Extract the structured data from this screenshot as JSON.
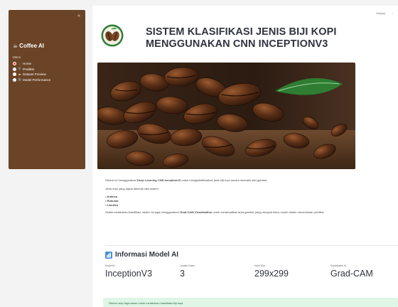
{
  "sidebar": {
    "collapse_icon": "«",
    "app_title": "Coffee AI",
    "menu_label": "Menu",
    "items": [
      {
        "label": "Home",
        "icon": "house-icon",
        "active": true
      },
      {
        "label": "Prediksi",
        "icon": "magnifier-icon",
        "active": false
      },
      {
        "label": "Dataset Preview",
        "icon": "folder-icon",
        "active": false
      },
      {
        "label": "Model Performance",
        "icon": "chart-icon",
        "active": false
      }
    ]
  },
  "topbar": {
    "deploy_label": "Deploy",
    "menu_icon": "⋮"
  },
  "header": {
    "title_line1": "SISTEM KLASIFIKASI JENIS BIJI KOPI",
    "title_line2": "MENGGUNAKAN CNN INCEPTIONV3"
  },
  "description": {
    "intro_pre": "Sistem ini menggunakan ",
    "intro_bold": "Deep Learning CNN InceptionV3",
    "intro_post": " untuk mengklasifikasikan jenis biji kopi secara otomatis dari gambar.",
    "types_intro": "Jenis kopi yang dapat dikenali oleh sistem:",
    "types": [
      "Arabica",
      "Robusta",
      "Liberika"
    ],
    "gradcam_pre": "Selain melakukan klasifikasi, sistem ini juga menggunakan ",
    "gradcam_bold": "Grad-CAM Visualization",
    "gradcam_post": " untuk menampilkan area gambar yang menjadi fokus model dalam menentukan prediksi."
  },
  "model_info": {
    "title": "Informasi Model AI",
    "icon": "bar-chart-icon",
    "metrics": [
      {
        "label": "Model AI",
        "value": "InceptionV3"
      },
      {
        "label": "Jumlah Kelas",
        "value": "3"
      },
      {
        "label": "Input Size",
        "value": "299x299"
      },
      {
        "label": "Explainable AI",
        "value": "Grad-CAM"
      }
    ]
  },
  "status": {
    "message": "Sistem siap digunakan untuk melakukan klasifikasi biji kopi."
  },
  "colors": {
    "sidebar_bg": "#6b4427",
    "accent_red": "#ff4b4b",
    "success_bg": "#dff5e6"
  }
}
